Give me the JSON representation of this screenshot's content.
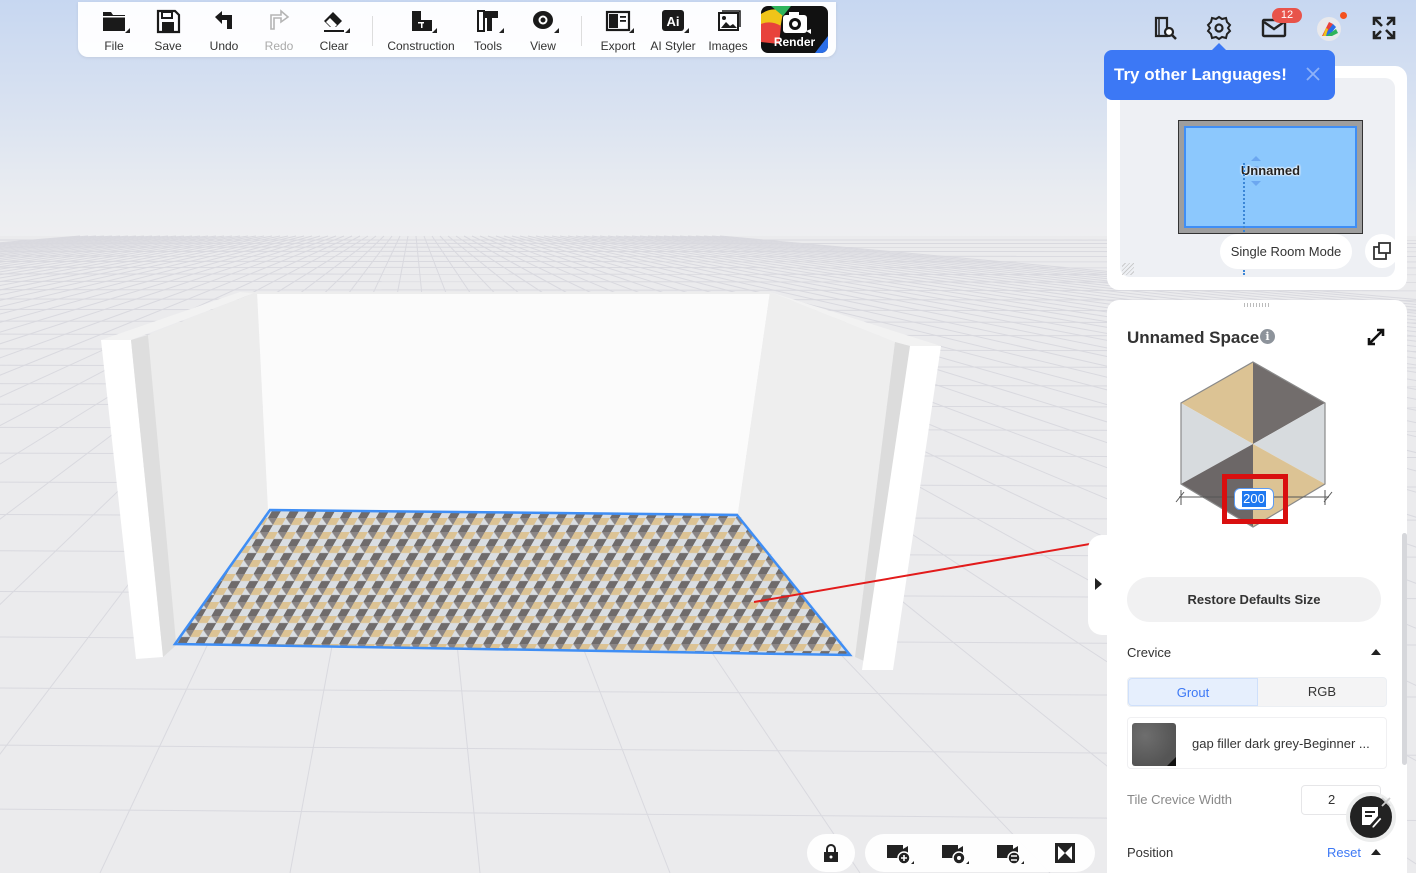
{
  "toolbar": {
    "items": [
      {
        "label": "File",
        "icon": "folder-icon",
        "has_menu": true,
        "enabled": true
      },
      {
        "label": "Save",
        "icon": "save-icon",
        "has_menu": false,
        "enabled": true
      },
      {
        "label": "Undo",
        "icon": "undo-icon",
        "has_menu": false,
        "enabled": true
      },
      {
        "label": "Redo",
        "icon": "redo-icon",
        "has_menu": false,
        "enabled": false
      },
      {
        "label": "Clear",
        "icon": "eraser-icon",
        "has_menu": true,
        "enabled": true
      },
      {
        "label": "Construction",
        "icon": "construction-icon",
        "has_menu": true,
        "enabled": true
      },
      {
        "label": "Tools",
        "icon": "tools-icon",
        "has_menu": true,
        "enabled": true
      },
      {
        "label": "View",
        "icon": "eye-icon",
        "has_menu": true,
        "enabled": true
      },
      {
        "label": "Export",
        "icon": "export-icon",
        "has_menu": true,
        "enabled": true
      },
      {
        "label": "AI Styler",
        "icon": "ai-icon",
        "has_menu": true,
        "enabled": true
      },
      {
        "label": "Images",
        "icon": "images-icon",
        "has_menu": false,
        "enabled": true
      }
    ],
    "render_label": "Render"
  },
  "top_right": {
    "mail_badge": "12",
    "icons": [
      "catalog-search-icon",
      "settings-icon",
      "mail-icon",
      "avatar",
      "fullscreen-icon"
    ]
  },
  "language_tip": {
    "text": "Try other Languages!"
  },
  "minimap": {
    "room_name": "Unnamed",
    "mode_button": "Single Room Mode"
  },
  "properties": {
    "title": "Unnamed Space",
    "tile_size_value": "200",
    "restore_button": "Restore Defaults Size",
    "crevice_label": "Crevice",
    "crevice_tabs": [
      {
        "label": "Grout",
        "active": true
      },
      {
        "label": "RGB",
        "active": false
      }
    ],
    "material_name": "gap filler dark grey-Beginner ...",
    "crevice_width_label": "Tile Crevice Width",
    "crevice_width_value": "2",
    "position_label": "Position",
    "reset_label": "Reset"
  },
  "colors": {
    "accent": "#3c78f5",
    "selection_outline": "#3f8ef5",
    "highlight_box": "#d90f0f",
    "tile_beige": "#dcc394",
    "tile_dark": "#6f6b6b",
    "tile_light": "#dadee2"
  },
  "bottom_toolbar": {
    "icons": [
      "lock-icon",
      "add-camera-icon",
      "camera-settings-icon",
      "switch-camera-icon",
      "bowtie-view-icon"
    ]
  }
}
